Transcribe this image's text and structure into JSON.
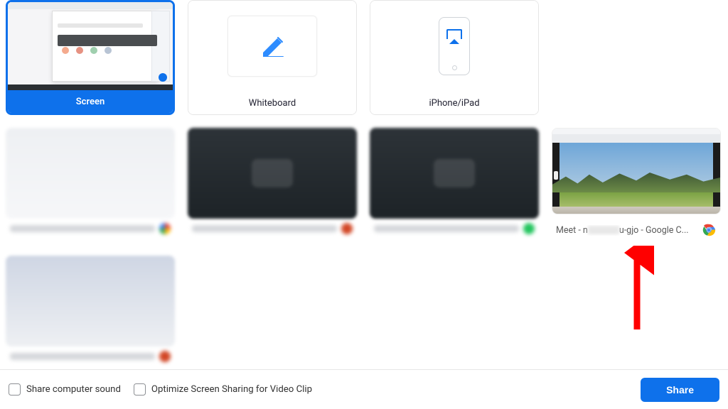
{
  "tiles": {
    "screen": {
      "label": "Screen",
      "selected": true
    },
    "whiteboard": {
      "label": "Whiteboard"
    },
    "iphone": {
      "label": "iPhone/iPad"
    }
  },
  "windows": {
    "meet": {
      "label_prefix": "Meet - n",
      "label_suffix": "u-gjo - Google C...",
      "app": "Google Chrome"
    }
  },
  "footer": {
    "share_sound": "Share computer sound",
    "optimize_video": "Optimize Screen Sharing for Video Clip",
    "share_button": "Share"
  },
  "colors": {
    "accent": "#0E71EB",
    "arrow": "#FF0000"
  }
}
